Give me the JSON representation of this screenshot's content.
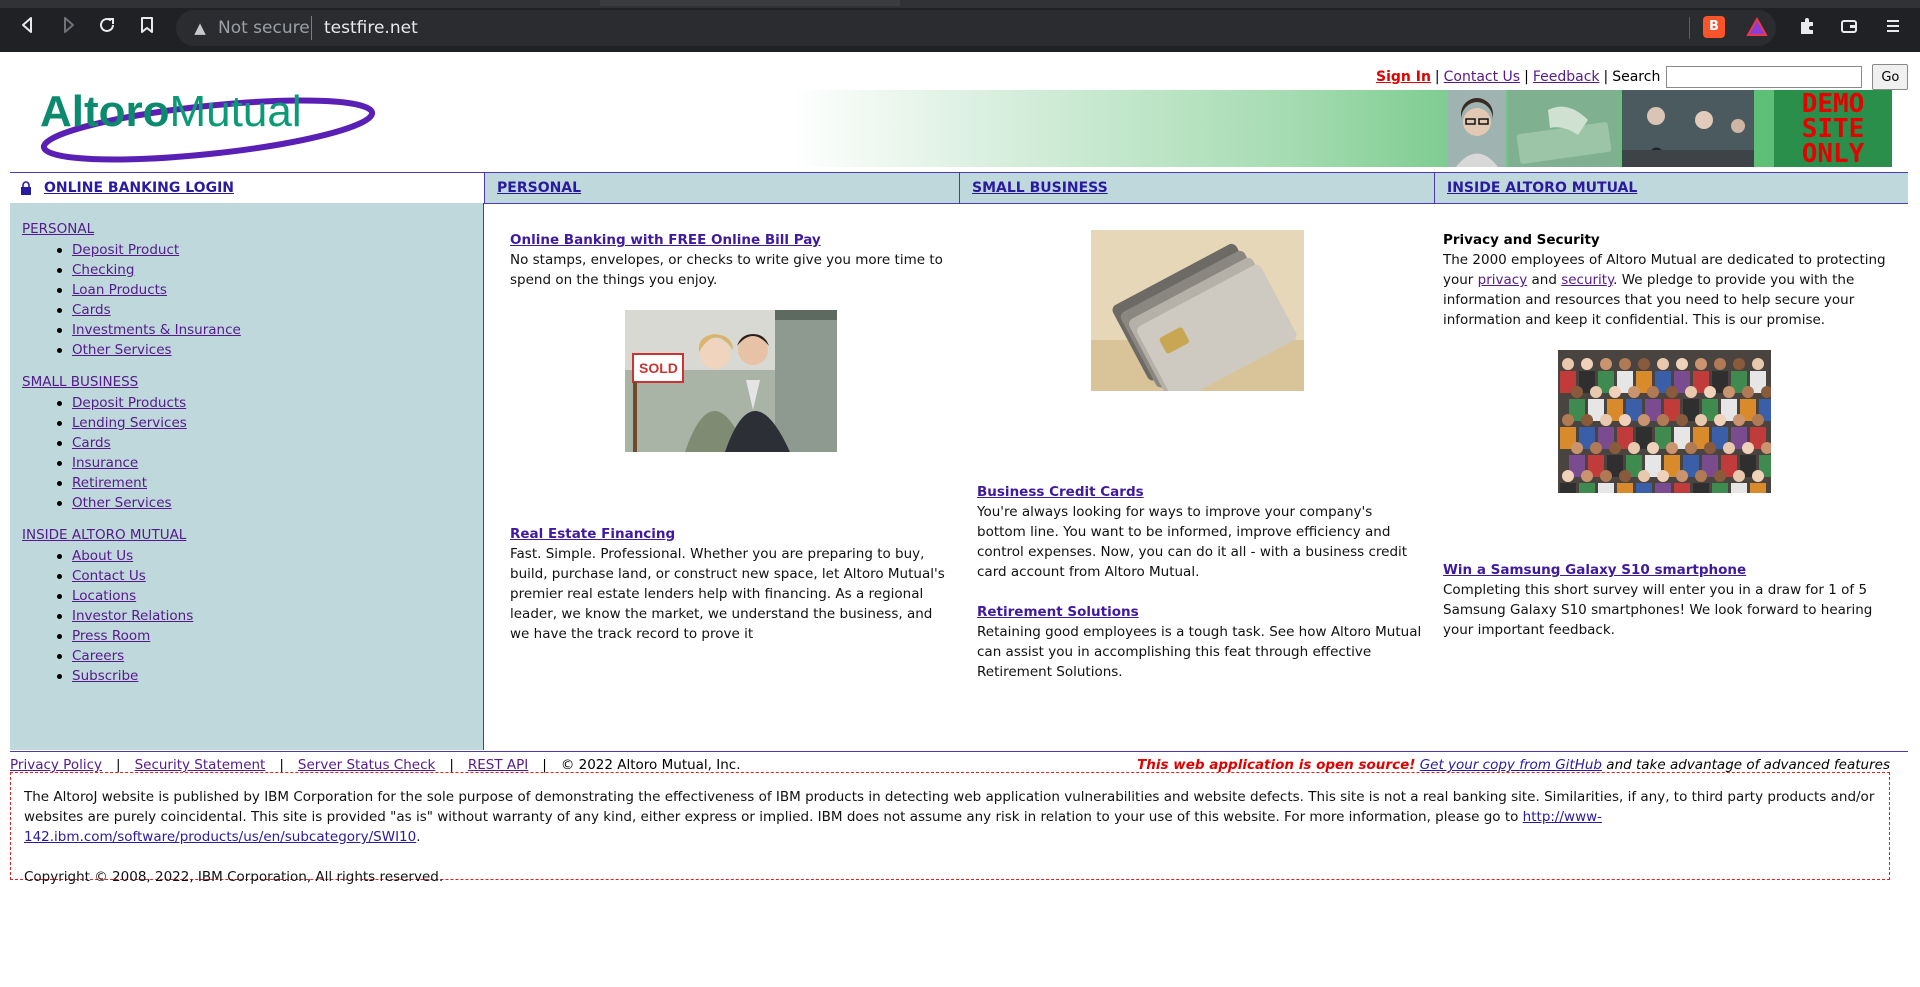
{
  "browser": {
    "security_label": "Not secure",
    "url": "testfire.net",
    "icons": [
      "back-icon",
      "forward-icon",
      "reload-icon",
      "bookmark-icon",
      "warning-icon",
      "brave-shield-icon",
      "rewards-triangle-icon",
      "extensions-icon",
      "wallet-icon",
      "menu-icon"
    ]
  },
  "header": {
    "logo_text_1": "Altoro",
    "logo_text_2": "Mutual",
    "sign_in": "Sign In",
    "contact_us": "Contact Us",
    "feedback": "Feedback",
    "search_label": "Search",
    "search_value": "",
    "go_label": "Go",
    "banner_demo_1": "DEMO",
    "banner_demo_2": "SITE",
    "banner_demo_3": "ONLY"
  },
  "nav": {
    "login": "ONLINE BANKING LOGIN",
    "personal": "PERSONAL",
    "small_business": "SMALL BUSINESS",
    "inside": "INSIDE ALTORO MUTUAL"
  },
  "sidebar": {
    "personal": {
      "heading": "PERSONAL",
      "items": [
        "Deposit Product",
        "Checking",
        "Loan Products",
        "Cards",
        "Investments & Insurance",
        "Other Services"
      ]
    },
    "small_business": {
      "heading": "SMALL BUSINESS",
      "items": [
        "Deposit Products",
        "Lending Services",
        "Cards",
        "Insurance",
        "Retirement",
        "Other Services"
      ]
    },
    "inside": {
      "heading": "INSIDE ALTORO MUTUAL",
      "items": [
        "About Us",
        "Contact Us",
        "Locations",
        "Investor Relations",
        "Press Room",
        "Careers",
        "Subscribe"
      ]
    }
  },
  "col1": {
    "h1": "Online Banking with FREE Online Bill Pay",
    "p1": "No stamps, envelopes, or checks to write give you more time to spend on the things you enjoy.",
    "h2": "Real Estate Financing",
    "p2": "Fast. Simple. Professional. Whether you are preparing to buy, build, purchase land, or construct new space, let Altoro Mutual's premier real estate lenders help with financing. As a regional leader, we know the market, we understand the business, and we have the track record to prove it",
    "sold_sign": "SOLD"
  },
  "col2": {
    "h1": "Business Credit Cards",
    "p1": "You're always looking for ways to improve your company's bottom line. You want to be informed, improve efficiency and control expenses. Now, you can do it all - with a business credit card account from Altoro Mutual.",
    "h2": "Retirement Solutions",
    "p2": "Retaining good employees is a tough task. See how Altoro Mutual can assist you in accomplishing this feat through effective Retirement Solutions."
  },
  "col3": {
    "h1": "Privacy and Security",
    "p1_a": "The 2000 employees of Altoro Mutual are dedicated to protecting your ",
    "privacy": "privacy",
    "p1_b": " and ",
    "security": "security",
    "p1_c": ". We pledge to provide you with the information and resources that you need to help secure your information and keep it confidential. This is our promise.",
    "h2": "Win a Samsung Galaxy S10 smartphone",
    "p2": "Completing this short survey will enter you in a draw for 1 of 5 Samsung Galaxy S10 smartphones! We look forward to hearing your important feedback."
  },
  "footer": {
    "privacy_policy": "Privacy Policy",
    "security_statement": "Security Statement",
    "server_status": "Server Status Check",
    "rest_api": "REST API",
    "copyright": "© 2022 Altoro Mutual, Inc.",
    "open_source": "This web application is open source!",
    "github": "Get your copy from GitHub",
    "advantage": " and take advantage of advanced features"
  },
  "disclaimer": {
    "text": "The AltoroJ website is published by IBM Corporation for the sole purpose of demonstrating the effectiveness of IBM products in detecting web application vulnerabilities and website defects. This site is not a real banking site. Similarities, if any, to third party products and/or websites are purely coincidental. This site is provided \"as is\" without warranty of any kind, either express or implied. IBM does not assume any risk in relation to your use of this website. For more information, please go to ",
    "link": "http://www-142.ibm.com/software/products/us/en/subcategory/SWI10",
    "period": ".",
    "copyright": "Copyright © 2008, 2022, IBM Corporation, All rights reserved."
  },
  "colors": {
    "link": "#551a8b",
    "nav_border": "#4d3ab3",
    "sidebar_bg": "#bfd8db",
    "signin": "#e00000",
    "demo_text": "#e60000"
  }
}
